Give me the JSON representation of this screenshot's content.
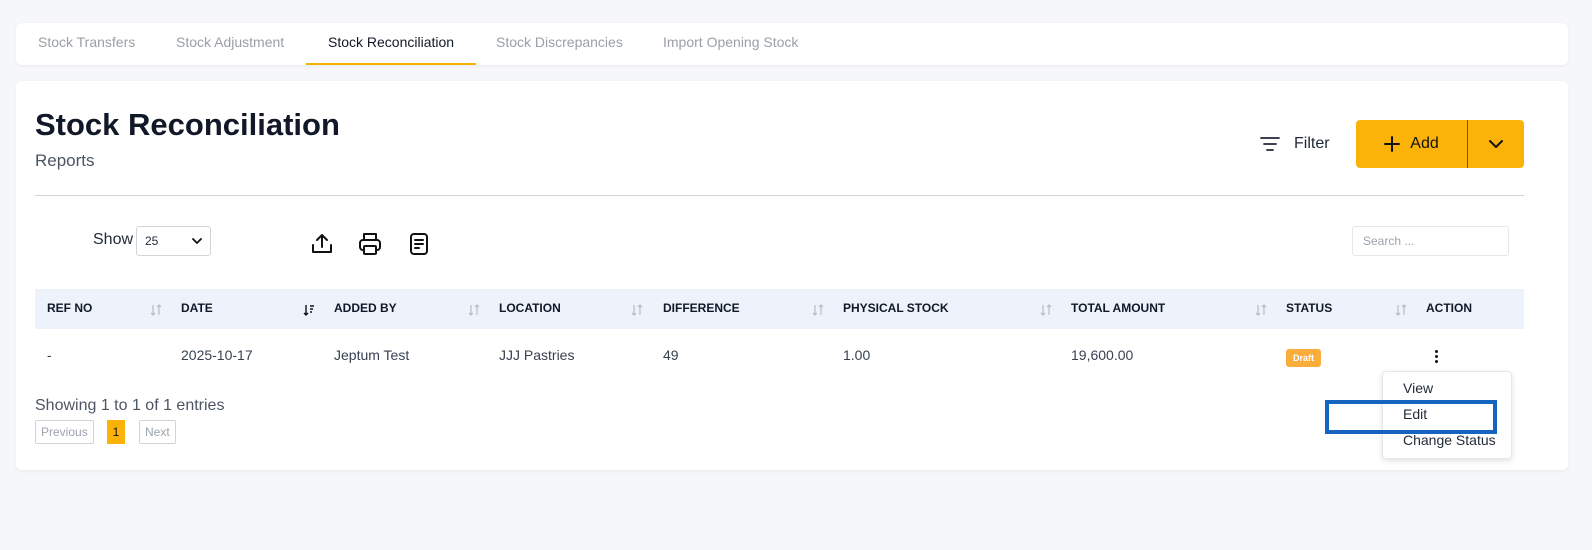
{
  "tabs": [
    {
      "label": "Stock Transfers",
      "active": false
    },
    {
      "label": "Stock Adjustment",
      "active": false
    },
    {
      "label": "Stock Reconciliation",
      "active": true
    },
    {
      "label": "Stock Discrepancies",
      "active": false
    },
    {
      "label": "Import Opening Stock",
      "active": false
    }
  ],
  "header": {
    "title": "Stock Reconciliation",
    "subtitle": "Reports"
  },
  "actions": {
    "filter_label": "Filter",
    "add_label": "Add"
  },
  "toolbar": {
    "show_label": "Show",
    "page_size": "25",
    "icons": [
      "export-icon",
      "print-icon",
      "document-icon"
    ],
    "search_placeholder": "Search ..."
  },
  "table": {
    "columns": [
      "REF NO",
      "DATE",
      "ADDED BY",
      "LOCATION",
      "DIFFERENCE",
      "PHYSICAL STOCK",
      "TOTAL AMOUNT",
      "STATUS",
      "ACTION"
    ],
    "rows": [
      {
        "ref_no": "-",
        "date": "2025-10-17",
        "added_by": "Jeptum Test",
        "location": "JJJ Pastries",
        "difference": "49",
        "physical_stock": "1.00",
        "total_amount": "19,600.00",
        "status": "Draft"
      }
    ]
  },
  "pagination": {
    "entries_text": "Showing 1 to 1 of 1 entries",
    "previous": "Previous",
    "current": "1",
    "next": "Next"
  },
  "action_menu": {
    "items": [
      "View",
      "Edit",
      "Change Status"
    ],
    "highlighted": "Edit"
  },
  "colors": {
    "accent": "#fbb30a",
    "badge": "#fbad3b",
    "highlight": "#1565c0",
    "header_bg": "#eef3fb"
  }
}
